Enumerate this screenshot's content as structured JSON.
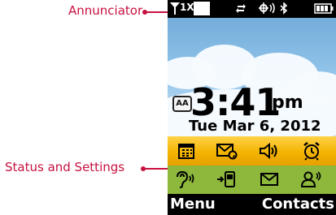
{
  "callouts": {
    "annunciator": "Annunciator",
    "status_settings": "Status and Settings"
  },
  "status_bar": {
    "signal_text": "1X",
    "icons": [
      "signal-icon",
      "sync-arrows-icon",
      "location-icon",
      "bluetooth-icon",
      "battery-icon"
    ]
  },
  "alarm_badge": "AA",
  "clock": {
    "time": "3:41",
    "ampm": "pm",
    "date": "Tue Mar 6, 2012"
  },
  "status_icons_row1": [
    "calendar-icon",
    "message-icon",
    "volume-icon",
    "alarm-clock-icon"
  ],
  "status_icons_row2": [
    "hearing-aid-icon",
    "call-forward-icon",
    "mail-icon",
    "contacts-icon"
  ],
  "softkeys": {
    "left": "Menu",
    "right": "Contacts"
  },
  "colors": {
    "callout": "#c8103e",
    "tray": "#f4b400",
    "sky": "#8cc0e7",
    "grass": "#8db83b"
  }
}
